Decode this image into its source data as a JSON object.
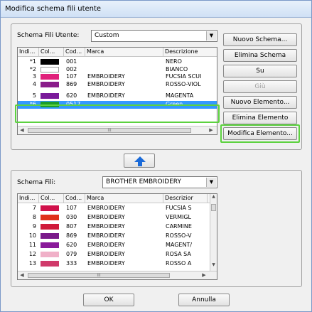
{
  "window": {
    "title": "Modifica schema fili utente"
  },
  "user_scheme": {
    "label": "Schema Fili Utente:",
    "select_value": "Custom",
    "columns": [
      "Indi...",
      "Col...",
      "Cod...",
      "Marca",
      "Descrizione"
    ],
    "rows": [
      {
        "index": "*1",
        "color": "#000000",
        "code": "001",
        "brand": "",
        "description": "NERO",
        "selected": false
      },
      {
        "index": "*2",
        "color": "#ffffff",
        "code": "002",
        "brand": "",
        "description": "BIANCO",
        "selected": false
      },
      {
        "index": "3",
        "color": "#e0207a",
        "code": "107",
        "brand": "EMBROIDERY",
        "description": "FUCSIA SCUI",
        "selected": false
      },
      {
        "index": "4",
        "color": "#8a1c8a",
        "code": "869",
        "brand": "EMBROIDERY",
        "description": "ROSSO-VIOL",
        "selected": false
      },
      {
        "index": "5",
        "color": "#7a1a9a",
        "code": "620",
        "brand": "EMBROIDERY",
        "description": "MAGENTA",
        "selected": false
      },
      {
        "index": "*6",
        "color": "#1a9e2a",
        "code": "0517",
        "brand": "",
        "description": "Green",
        "selected": true
      }
    ],
    "scroll_thumb": "III"
  },
  "side_buttons": {
    "new_scheme": "Nuovo Schema...",
    "delete_scheme": "Elimina Schema",
    "up": "Su",
    "down": "Giù",
    "new_element": "Nuovo Elemento...",
    "delete_element": "Elimina Elemento",
    "edit_element": "Modifica Elemento..."
  },
  "thread_scheme": {
    "label": "Schema Fili:",
    "select_value": "BROTHER EMBROIDERY",
    "columns": [
      "Indi...",
      "Col...",
      "Cod...",
      "Marca",
      "Descrizior"
    ],
    "rows": [
      {
        "index": "7",
        "color": "#d0104a",
        "code": "107",
        "brand": "EMBROIDERY",
        "description": "FUCSIA S"
      },
      {
        "index": "8",
        "color": "#e0301a",
        "code": "030",
        "brand": "EMBROIDERY",
        "description": "VERMIGL"
      },
      {
        "index": "9",
        "color": "#d01a3a",
        "code": "807",
        "brand": "EMBROIDERY",
        "description": "CARMINE"
      },
      {
        "index": "10",
        "color": "#7a1a8a",
        "code": "869",
        "brand": "EMBROIDERY",
        "description": "ROSSO-V"
      },
      {
        "index": "11",
        "color": "#8a1a9a",
        "code": "620",
        "brand": "EMBROIDERY",
        "description": "MAGENT/"
      },
      {
        "index": "12",
        "color": "#f0b0c8",
        "code": "079",
        "brand": "EMBROIDERY",
        "description": "ROSA SA"
      },
      {
        "index": "13",
        "color": "#d03a6a",
        "code": "333",
        "brand": "EMBROIDERY",
        "description": "ROSSO A"
      }
    ],
    "scroll_thumb": "III"
  },
  "footer": {
    "ok": "OK",
    "cancel": "Annulla"
  },
  "colors": {
    "selection": "#3399ff",
    "highlight": "#5cd23f",
    "arrow": "#1a6ad8"
  },
  "icons": {
    "up_arrow": "up-arrow-icon"
  }
}
